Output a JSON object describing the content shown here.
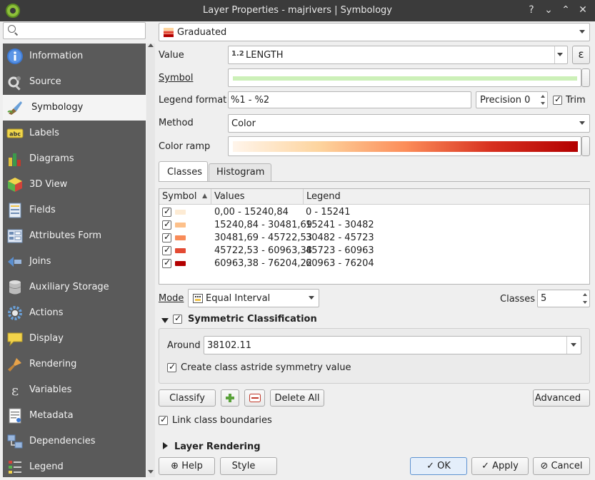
{
  "window": {
    "title": "Layer Properties - majrivers | Symbology"
  },
  "search": {
    "placeholder": ""
  },
  "sidebar": {
    "items": [
      {
        "label": "Information",
        "icon": "info-icon"
      },
      {
        "label": "Source",
        "icon": "wrench-icon"
      },
      {
        "label": "Symbology",
        "icon": "brush-icon"
      },
      {
        "label": "Labels",
        "icon": "abc-label-icon"
      },
      {
        "label": "Diagrams",
        "icon": "diagram-icon"
      },
      {
        "label": "3D View",
        "icon": "cube-icon"
      },
      {
        "label": "Fields",
        "icon": "fields-icon"
      },
      {
        "label": "Attributes Form",
        "icon": "form-icon"
      },
      {
        "label": "Joins",
        "icon": "join-icon"
      },
      {
        "label": "Auxiliary Storage",
        "icon": "database-icon"
      },
      {
        "label": "Actions",
        "icon": "gear-icon"
      },
      {
        "label": "Display",
        "icon": "speech-bubble-icon"
      },
      {
        "label": "Rendering",
        "icon": "paintbrush-icon"
      },
      {
        "label": "Variables",
        "icon": "epsilon-icon"
      },
      {
        "label": "Metadata",
        "icon": "document-icon"
      },
      {
        "label": "Dependencies",
        "icon": "dependencies-icon"
      },
      {
        "label": "Legend",
        "icon": "legend-icon"
      }
    ],
    "active_index": 2
  },
  "renderer": {
    "value": "Graduated"
  },
  "value": {
    "label": "Value",
    "field_type": "1.2",
    "field": "LENGTH"
  },
  "symbol": {
    "label": "Symbol",
    "color": "#ccf0b8"
  },
  "legend_format": {
    "label": "Legend format",
    "value": "%1 - %2",
    "precision_label": "Precision 0",
    "trim_label": "Trim"
  },
  "method": {
    "label": "Method",
    "value": "Color"
  },
  "color_ramp": {
    "label": "Color ramp",
    "start_color": "#fff5eb",
    "end_color": "#b30000"
  },
  "tabs": [
    {
      "label": "Classes"
    },
    {
      "label": "Histogram"
    }
  ],
  "table": {
    "headers": [
      "Symbol",
      "Values",
      "Legend"
    ],
    "rows": [
      {
        "color": "#fdebd4",
        "values": "0,00 - 15240,84",
        "legend": "0 - 15241"
      },
      {
        "color": "#fdc08a",
        "values": "15240,84 - 30481,69",
        "legend": "15241 - 30482"
      },
      {
        "color": "#f88b58",
        "values": "30481,69 - 45722,53",
        "legend": "30482 - 45723"
      },
      {
        "color": "#e34a33",
        "values": "45722,53 - 60963,38",
        "legend": "45723 - 60963"
      },
      {
        "color": "#b30000",
        "values": "60963,38 - 76204,22",
        "legend": "60963 - 76204"
      }
    ]
  },
  "mode": {
    "label": "Mode",
    "value": "Equal Interval",
    "classes_label": "Classes",
    "classes_value": "5"
  },
  "symmetric": {
    "label": "Symmetric Classification",
    "around_label": "Around",
    "around_value": "38102.11",
    "astride_label": "Create class astride symmetry value"
  },
  "buttons": {
    "classify": "Classify",
    "delete_all": "Delete All",
    "advanced": "Advanced",
    "link_boundaries": "Link class boundaries"
  },
  "layer_rendering": {
    "label": "Layer Rendering"
  },
  "footer": {
    "help": "Help",
    "style": "Style",
    "ok": "OK",
    "apply": "Apply",
    "cancel": "Cancel"
  }
}
